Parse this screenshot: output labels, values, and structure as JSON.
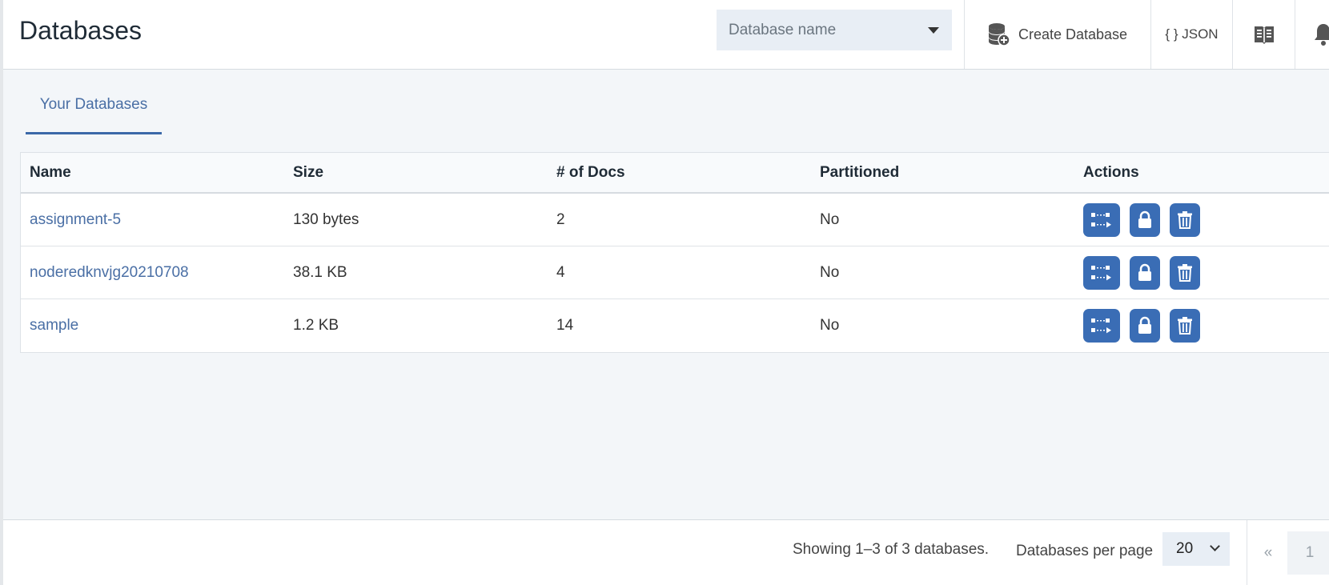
{
  "header": {
    "title": "Databases",
    "search_placeholder": "Database name",
    "create_label": "Create Database",
    "json_label": "{ } JSON"
  },
  "tabs": [
    {
      "label": "Your Databases",
      "active": true
    }
  ],
  "table": {
    "columns": [
      "Name",
      "Size",
      "# of Docs",
      "Partitioned",
      "Actions"
    ],
    "rows": [
      {
        "name": "assignment-5",
        "size": "130 bytes",
        "docs": "2",
        "partitioned": "No"
      },
      {
        "name": "noderedknvjg20210708",
        "size": "38.1 KB",
        "docs": "4",
        "partitioned": "No"
      },
      {
        "name": "sample",
        "size": "1.2 KB",
        "docs": "14",
        "partitioned": "No"
      }
    ],
    "action_icons": [
      "replicate-icon",
      "lock-icon",
      "trash-icon"
    ]
  },
  "footer": {
    "showing": "Showing 1–3 of 3 databases.",
    "per_page_label": "Databases per page",
    "per_page_value": "20",
    "prev": "«",
    "page": "1"
  },
  "colors": {
    "accent": "#3a6db5",
    "link": "#4a6fa5"
  }
}
